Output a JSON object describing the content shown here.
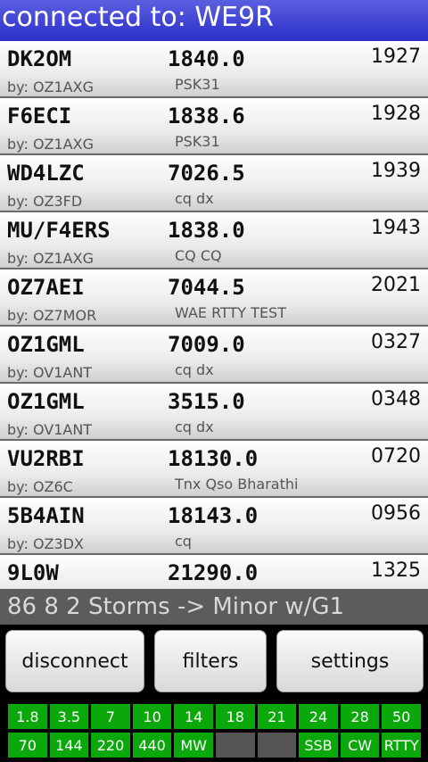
{
  "title": "connected to: WE9R",
  "spots": [
    {
      "call": "DK2OM",
      "freq": "1840.0",
      "time": "1927",
      "by": "by: OZ1AXG",
      "comment": "PSK31"
    },
    {
      "call": "F6ECI",
      "freq": "1838.6",
      "time": "1928",
      "by": "by: OZ1AXG",
      "comment": "PSK31"
    },
    {
      "call": "WD4LZC",
      "freq": "7026.5",
      "time": "1939",
      "by": "by: OZ3FD",
      "comment": "cq dx"
    },
    {
      "call": "MU/F4ERS",
      "freq": "1838.0",
      "time": "1943",
      "by": "by: OZ1AXG",
      "comment": "CQ CQ"
    },
    {
      "call": "OZ7AEI",
      "freq": "7044.5",
      "time": "2021",
      "by": "by: OZ7MOR",
      "comment": "WAE RTTY TEST"
    },
    {
      "call": "OZ1GML",
      "freq": "7009.0",
      "time": "0327",
      "by": "by: OV1ANT",
      "comment": "cq dx"
    },
    {
      "call": "OZ1GML",
      "freq": "3515.0",
      "time": "0348",
      "by": "by: OV1ANT",
      "comment": "cq dx"
    },
    {
      "call": "VU2RBI",
      "freq": "18130.0",
      "time": "0720",
      "by": "by: OZ6C",
      "comment": "Tnx Qso Bharathi"
    },
    {
      "call": "5B4AIN",
      "freq": "18143.0",
      "time": "0956",
      "by": "by: OZ3DX",
      "comment": "cq"
    },
    {
      "call": "9L0W",
      "freq": "21290.0",
      "time": "1325",
      "by": "",
      "comment": ""
    }
  ],
  "status_line": "86  8  2  Storms -> Minor w/G1",
  "buttons": {
    "disconnect": "disconnect",
    "filters": "filters",
    "settings": "settings"
  },
  "bands_row1": [
    {
      "label": "1.8",
      "enabled": true
    },
    {
      "label": "3.5",
      "enabled": true
    },
    {
      "label": "7",
      "enabled": true
    },
    {
      "label": "10",
      "enabled": true
    },
    {
      "label": "14",
      "enabled": true
    },
    {
      "label": "18",
      "enabled": true
    },
    {
      "label": "21",
      "enabled": true
    },
    {
      "label": "24",
      "enabled": true
    },
    {
      "label": "28",
      "enabled": true
    },
    {
      "label": "50",
      "enabled": true
    }
  ],
  "bands_row2": [
    {
      "label": "70",
      "enabled": true
    },
    {
      "label": "144",
      "enabled": true
    },
    {
      "label": "220",
      "enabled": true
    },
    {
      "label": "440",
      "enabled": true
    },
    {
      "label": "MW",
      "enabled": true
    },
    {
      "label": "",
      "enabled": false
    },
    {
      "label": "",
      "enabled": false
    },
    {
      "label": "SSB",
      "enabled": true
    },
    {
      "label": "CW",
      "enabled": true
    },
    {
      "label": "RTTY",
      "enabled": true
    }
  ],
  "colors": {
    "title_bar": "#2b2fc8",
    "band_on": "#0aa80a",
    "band_off": "#555555",
    "status_bar": "#5c5c5c"
  }
}
